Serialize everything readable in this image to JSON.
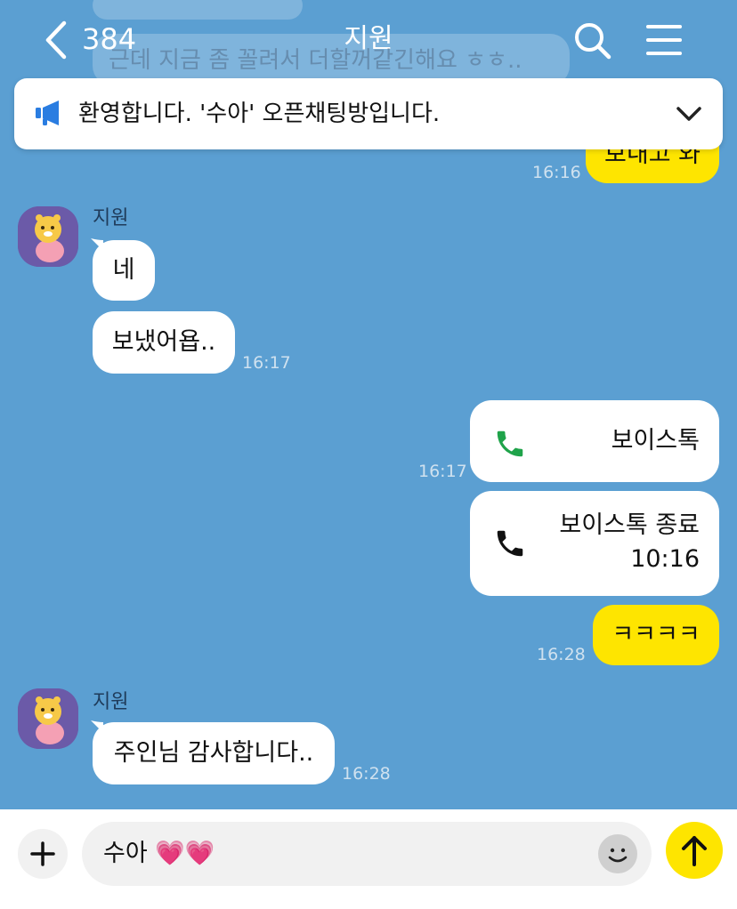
{
  "header": {
    "back_count": "384",
    "title": "지원"
  },
  "faded": {
    "line1": "",
    "line2": "근데 지금 좀 꼴려서 더할꺼같긴해요 ㅎㅎ.."
  },
  "notice": {
    "text": "환영합니다. '수아' 오픈채팅방입니다."
  },
  "messages": {
    "m0": {
      "text": "보내고 와",
      "time": "16:16"
    },
    "m1": {
      "sender": "지원",
      "text": "네"
    },
    "m2": {
      "text": "보냈어욥..",
      "time": "16:17"
    },
    "m3": {
      "text": "보이스톡",
      "time": "16:17",
      "icon": "phone-green-icon"
    },
    "m4": {
      "text": "보이스톡 종료",
      "duration": "10:16",
      "icon": "phone-black-icon"
    },
    "m5": {
      "text": "ㅋㅋㅋㅋ",
      "time": "16:28"
    },
    "m6": {
      "sender": "지원",
      "text": "주인님 감사합니다..",
      "time": "16:28"
    }
  },
  "input": {
    "value": "수아 💗💗"
  },
  "colors": {
    "background": "#5b9fd2",
    "yellow_bubble": "#fee500",
    "white_bubble": "#ffffff",
    "notice_icon": "#2a7de1",
    "call_green": "#1fa34a"
  }
}
